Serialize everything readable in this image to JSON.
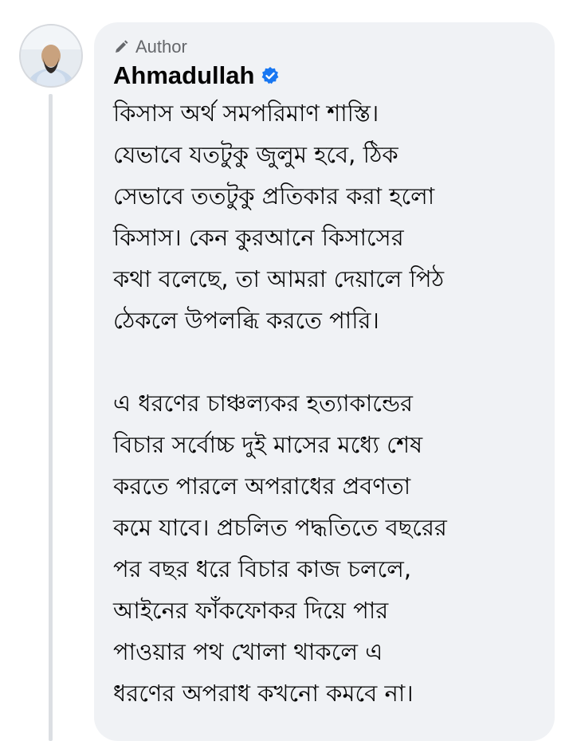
{
  "comment": {
    "author_badge": "Author",
    "author_name": "Ahmadullah",
    "verified": true,
    "text": "কিসাস অর্থ সমপরিমাণ শাস্তি।\nযেভাবে যতটুকু জুলুম হবে, ঠিক\nসেভাবে ততটুকু প্রতিকার করা হলো\nকিসাস। কেন কুরআনে কিসাসের\nকথা বলেছে, তা আমরা দেয়ালে পিঠ\nঠেকলে উপলব্ধি করতে পারি।\n\nএ ধরণের চাঞ্চল্যকর হত্যাকান্ডের\nবিচার সর্বোচ্চ দুই মাসের মধ্যে শেষ\nকরতে পারলে অপরাধের প্রবণতা\nকমে যাবে। প্রচলিত পদ্ধতিতে বছরের\nপর বছর ধরে বিচার কাজ চললে,\nআইনের ফাঁকফোকর দিয়ে পার\nপাওয়ার পথ খোলা থাকলে এ\nধরণের অপরাধ কখনো কমবে না।"
  },
  "icons": {
    "author_badge_icon": "pencil-icon",
    "verified_icon": "verified-badge-icon"
  },
  "colors": {
    "bubble_background": "#f0f2f5",
    "text": "#050505",
    "secondary_text": "#65676b",
    "verified_blue": "#1877f2",
    "thread_line": "#dcdfe3"
  }
}
